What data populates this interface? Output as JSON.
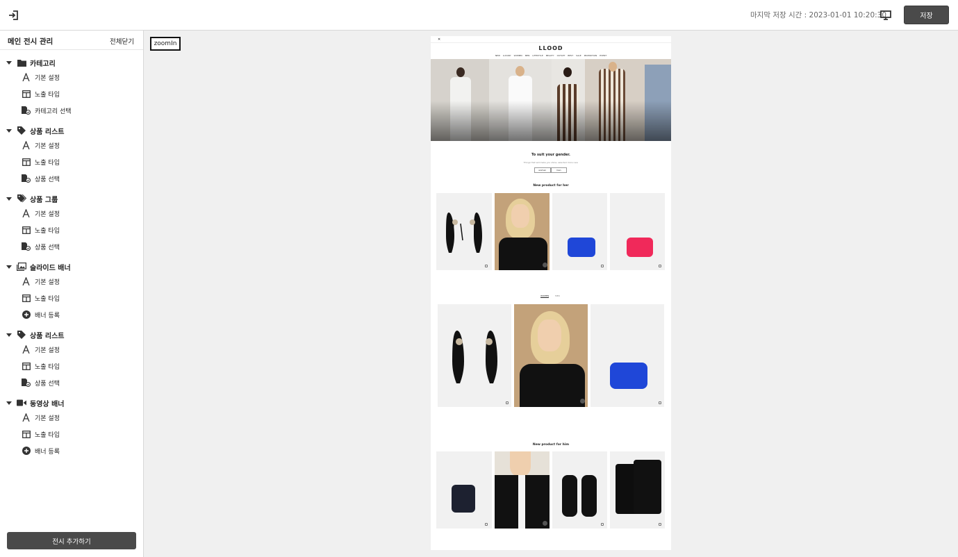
{
  "header": {
    "last_saved_label": "마지막 저장 시간 : 2023-01-01 10:20:30",
    "save_label": "저장",
    "exit_icon": "exit-icon",
    "monitor_icon": "monitor-icon"
  },
  "sidebar": {
    "title": "메인 전시 관리",
    "close_all": "전체닫기",
    "add_display": "전시 추가하기",
    "groups": [
      {
        "label": "카테고리",
        "icon": "folder-icon",
        "items": [
          {
            "label": "기본 설정",
            "icon": "text-icon"
          },
          {
            "label": "노출 타입",
            "icon": "layout-icon"
          },
          {
            "label": "카테고리 선택",
            "icon": "file-select-icon"
          }
        ]
      },
      {
        "label": "상품 리스트",
        "icon": "tag-icon",
        "items": [
          {
            "label": "기본 설정",
            "icon": "text-icon"
          },
          {
            "label": "노출 타입",
            "icon": "layout-icon"
          },
          {
            "label": "상품 선택",
            "icon": "file-select-icon"
          }
        ]
      },
      {
        "label": "상품 그룹",
        "icon": "tags-icon",
        "items": [
          {
            "label": "기본 설정",
            "icon": "text-icon"
          },
          {
            "label": "노출 타입",
            "icon": "layout-icon"
          },
          {
            "label": "상품 선택",
            "icon": "file-select-icon"
          }
        ]
      },
      {
        "label": "슬라이드 배너",
        "icon": "image-icon",
        "items": [
          {
            "label": "기본 설정",
            "icon": "text-icon"
          },
          {
            "label": "노출 타입",
            "icon": "layout-icon"
          },
          {
            "label": "배너 등록",
            "icon": "plus-circle-icon"
          }
        ]
      },
      {
        "label": "상품 리스트",
        "icon": "tag-icon",
        "items": [
          {
            "label": "기본 설정",
            "icon": "text-icon"
          },
          {
            "label": "노출 타입",
            "icon": "layout-icon"
          },
          {
            "label": "상품 선택",
            "icon": "file-select-icon"
          }
        ]
      },
      {
        "label": "동영상 배너",
        "icon": "video-icon",
        "items": [
          {
            "label": "기본 설정",
            "icon": "text-icon"
          },
          {
            "label": "노출 타입",
            "icon": "layout-icon"
          },
          {
            "label": "배너 등록",
            "icon": "plus-circle-icon"
          }
        ]
      }
    ]
  },
  "canvas": {
    "zoom_label": "zoomIn"
  },
  "preview": {
    "logo": "LLOOD",
    "nav": [
      "NEW",
      "LUXURY",
      "WOMEN",
      "MEN",
      "LIFESTYLE",
      "BEAUTY",
      "OUTLET",
      "BEST",
      "SALE",
      "PROMOTION",
      "EVENT"
    ],
    "gender_title": "To suit your gender.",
    "gender_sub": "Things that will make you shine, selected more new.",
    "gender_options": [
      "women",
      "men"
    ],
    "her_title": "New product for her",
    "him_title": "New product for him",
    "tabs": [
      "WOMEN",
      "MEN"
    ]
  },
  "colors": {
    "button_dark": "#4a4a4a",
    "canvas_bg": "#f0f0f0",
    "bag_blue": "#1f47d8",
    "bag_pink": "#f0295a"
  }
}
